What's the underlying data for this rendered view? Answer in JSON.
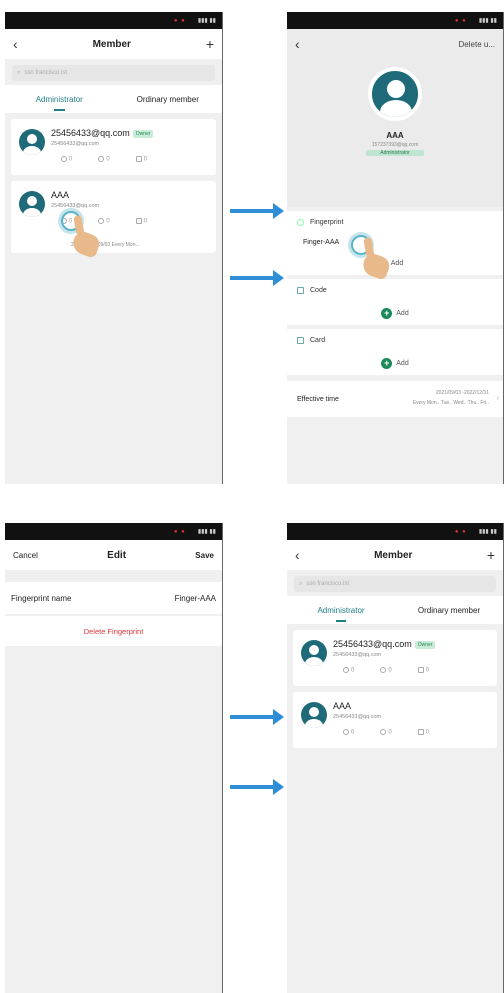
{
  "screen1": {
    "title": "Member",
    "search_placeholder": "ssn francisco.ist",
    "tabs": [
      "Administrator",
      "Ordinary member"
    ],
    "members": [
      {
        "name": "25456433@qq.com",
        "badge": "Owner",
        "email": "25456433@qq.com",
        "counts": [
          "0",
          "0",
          "0"
        ]
      },
      {
        "name": "AAA",
        "badge": "",
        "email": "25456433@qq.com",
        "counts": [
          "0",
          "0",
          "0"
        ],
        "effective": "2021 -2022/09/03 Every Mon..."
      }
    ]
  },
  "screen2": {
    "right_action": "Delete u...",
    "profile": {
      "name": "AAA",
      "id": "157237393@qq.com",
      "role": "Administrator"
    },
    "sections": [
      {
        "title": "Fingerprint",
        "items": [
          "Finger-AAA"
        ],
        "add_label": "Add"
      },
      {
        "title": "Code",
        "items": [],
        "add_label": "Add"
      },
      {
        "title": "Card",
        "items": [],
        "add_label": "Add"
      }
    ],
    "effective": {
      "label": "Effective time",
      "range": "2021/09/03 -2022/12/31",
      "days": "Every Mon.. Tue.. Wed.. Thu.. Fri.."
    }
  },
  "screen3": {
    "cancel": "Cancel",
    "title": "Edit",
    "save": "Save",
    "field_label": "Fingerprint name",
    "field_value": "Finger-AAA",
    "delete": "Delete Fingerprint"
  },
  "screen4": {
    "title": "Member",
    "search_placeholder": "ssn francisco.ist",
    "tabs": [
      "Administrator",
      "Ordinary member"
    ],
    "members": [
      {
        "name": "25456433@qq.com",
        "badge": "Owner",
        "email": "25456433@qq.com",
        "counts": [
          "0",
          "0",
          "0"
        ]
      },
      {
        "name": "AAA",
        "badge": "",
        "email": "25456433@qq.com",
        "counts": [
          "0",
          "0",
          "0"
        ]
      }
    ]
  },
  "colors": {
    "accent": "#1f7e86",
    "arrow": "#2f8fd6",
    "add": "#1b8a58",
    "delete": "#d9363e"
  }
}
